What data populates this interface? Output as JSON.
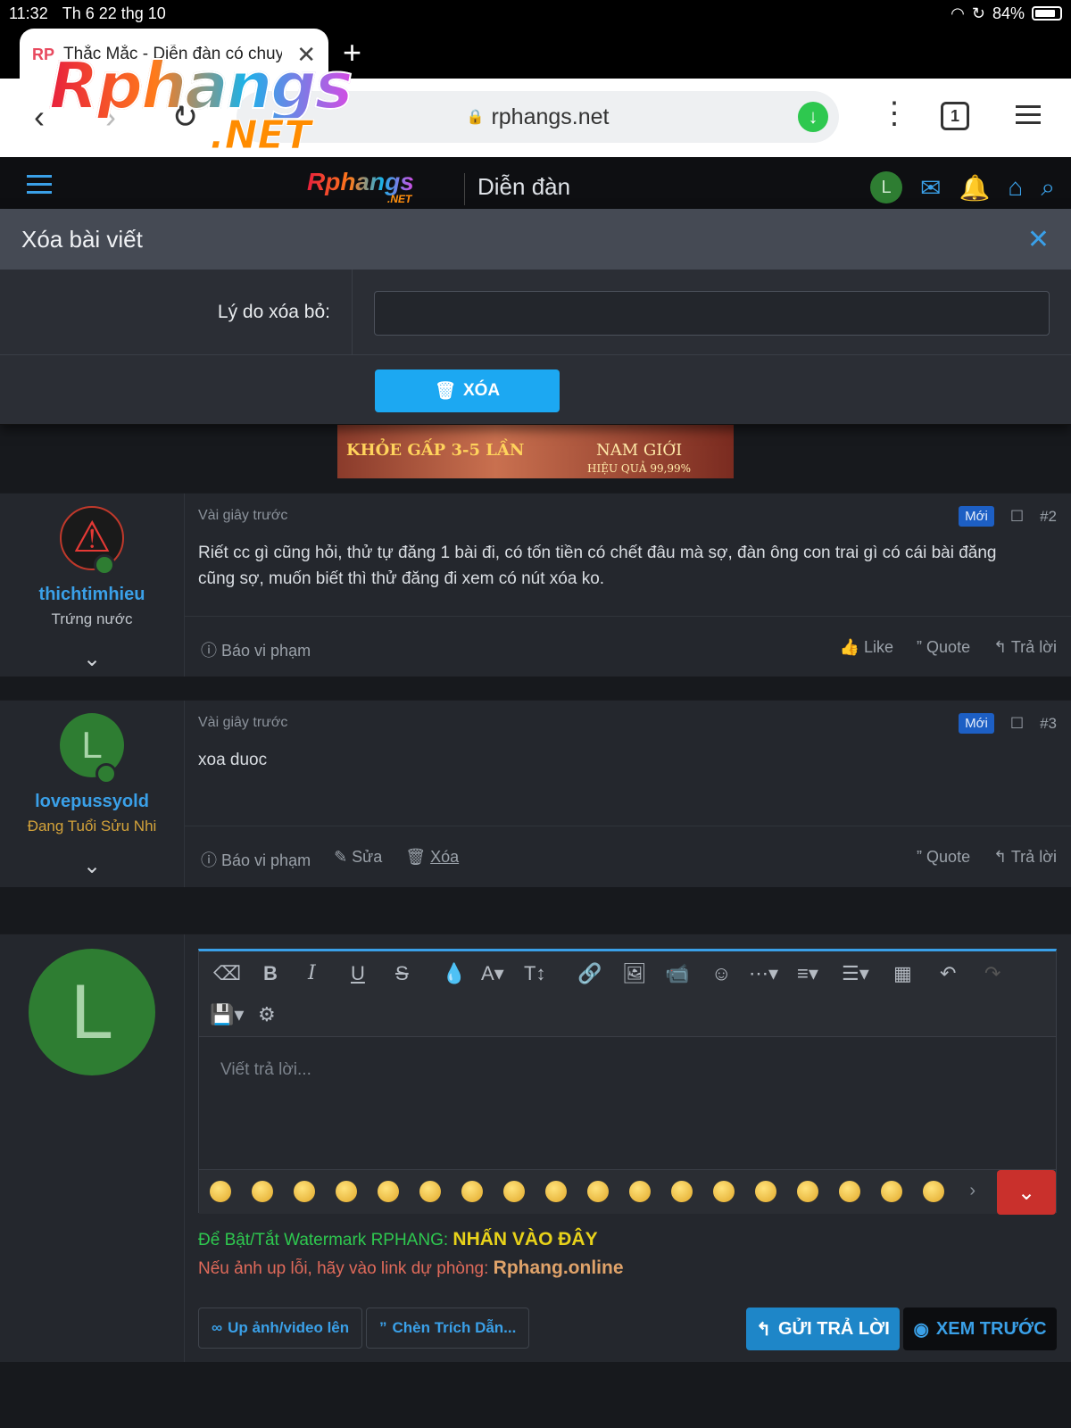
{
  "status": {
    "time": "11:32",
    "date": "Th 6 22 thg 10",
    "battery": "84%"
  },
  "browser": {
    "tab_favicon": "RP",
    "tab_title": "Thắc Mắc - Diễn đàn có chuyện",
    "url": "rphangs.net",
    "tab_count": "1"
  },
  "watermark_logo": {
    "main": "Rphangs",
    "sub": ".NET"
  },
  "site": {
    "logo": "Rphangs",
    "logo_sub": ".NET",
    "section": "Diễn đàn",
    "avatar_letter": "L"
  },
  "dialog": {
    "title": "Xóa bài viết",
    "reason_label": "Lý do xóa bỏ:",
    "reason_value": "",
    "delete_button": "XÓA"
  },
  "banner": {
    "text_left": "KHỎE GẤP 3-5 LẦN",
    "text_right": "NAM GIỚI",
    "text_small": "HIỆU QUẢ 99,99%"
  },
  "posts": [
    {
      "author": "thichtimhieu",
      "user_title": "Trứng nước",
      "time": "Vài giây trước",
      "badge": "Mới",
      "number": "#2",
      "body": "Riết cc gì cũng hỏi, thử tự đăng 1 bài đi, có tốn tiền có chết đâu mà sợ, đàn ông con trai gì có cái bài đăng cũng sợ, muốn biết thì thử đăng đi xem có nút xóa ko.",
      "report": "Báo vi phạm",
      "like": "Like",
      "quote": "Quote",
      "reply": "Trả lời"
    },
    {
      "author": "lovepussyold",
      "avatar_letter": "L",
      "user_title": "Đang Tuổi Sửu Nhi",
      "time": "Vài giây trước",
      "badge": "Mới",
      "number": "#3",
      "body": "xoa duoc",
      "report": "Báo vi phạm",
      "edit": "Sửa",
      "delete": "Xóa",
      "quote": "Quote",
      "reply": "Trả lời"
    }
  ],
  "editor": {
    "avatar_letter": "L",
    "placeholder": "Viết trả lời...",
    "watermark_line": "Để Bật/Tắt Watermark RPHANG:",
    "watermark_link": "NHẤN VÀO ĐÂY",
    "backup_line": "Nếu ảnh up lỗi, hãy vào link dự phòng:",
    "backup_link": "Rphang.online",
    "upload_button": "Up ảnh/video lên",
    "insert_quote_button": "Chèn Trích Dẫn...",
    "send_button": "GỬI TRẢ LỜI",
    "preview_button": "XEM TRƯỚC"
  }
}
